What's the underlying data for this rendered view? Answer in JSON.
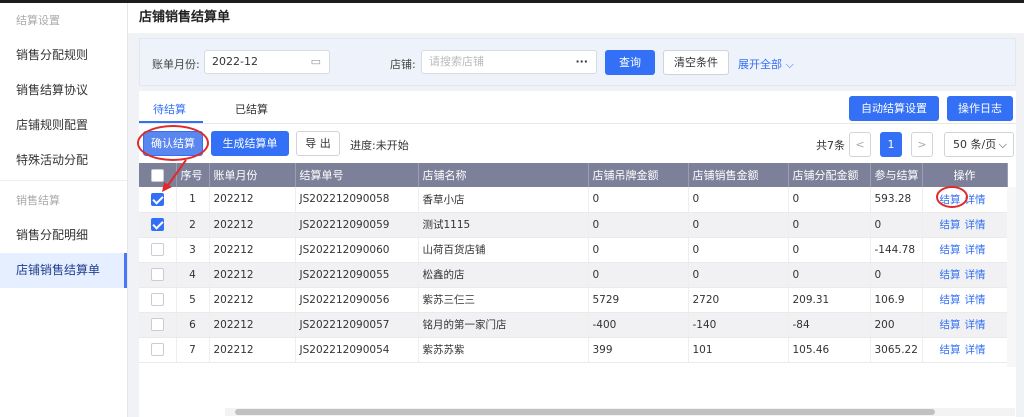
{
  "sidebar": {
    "items": [
      {
        "label": "结算设置",
        "type": "group"
      },
      {
        "label": "销售分配规则",
        "type": "item"
      },
      {
        "label": "销售结算协议",
        "type": "item"
      },
      {
        "label": "店铺规则配置",
        "type": "item"
      },
      {
        "label": "特殊活动分配",
        "type": "item"
      },
      {
        "label": "销售结算",
        "type": "group"
      },
      {
        "label": "销售分配明细",
        "type": "item"
      },
      {
        "label": "店铺销售结算单",
        "type": "active"
      }
    ]
  },
  "page": {
    "title": "店铺销售结算单"
  },
  "filter": {
    "month_label": "账单月份:",
    "month_value": "2022-12",
    "store_label": "店铺:",
    "store_placeholder": "请搜索店铺",
    "store_more": "···",
    "query_btn": "查询",
    "clear_btn": "清空条件",
    "expand_link": "展开全部"
  },
  "tabs": {
    "pending": "待结算",
    "settled": "已结算"
  },
  "toolbar": {
    "auto_settle_btn": "自动结算设置",
    "log_btn": "操作日志",
    "confirm_btn": "确认结算",
    "generate_btn": "生成结算单",
    "export_btn": "导 出",
    "progress": "进度:未开始",
    "total": "共7条",
    "prev": "<",
    "page": "1",
    "next": ">",
    "page_size": "50 条/页"
  },
  "table": {
    "headers": [
      "序号",
      "账单月份",
      "结算单号",
      "店铺名称",
      "店铺吊牌金额",
      "店铺销售金额",
      "店铺分配金额",
      "参与结算",
      "操作"
    ],
    "rows": [
      {
        "checked": true,
        "no": "1",
        "month": "202212",
        "code": "JS202212090058",
        "store": "香草小店",
        "tag": "0",
        "sale": "0",
        "alloc": "0",
        "settle": "593.28"
      },
      {
        "checked": true,
        "no": "2",
        "month": "202212",
        "code": "JS202212090059",
        "store": "测试1115",
        "tag": "0",
        "sale": "0",
        "alloc": "0",
        "settle": "0"
      },
      {
        "checked": false,
        "no": "3",
        "month": "202212",
        "code": "JS202212090060",
        "store": "山荷百货店铺",
        "tag": "0",
        "sale": "0",
        "alloc": "0",
        "settle": "-144.78"
      },
      {
        "checked": false,
        "no": "4",
        "month": "202212",
        "code": "JS202212090055",
        "store": "松鑫的店",
        "tag": "0",
        "sale": "0",
        "alloc": "0",
        "settle": "0"
      },
      {
        "checked": false,
        "no": "5",
        "month": "202212",
        "code": "JS202212090056",
        "store": "紫苏三仨三",
        "tag": "5729",
        "sale": "2720",
        "alloc": "209.31",
        "settle": "106.9"
      },
      {
        "checked": false,
        "no": "6",
        "month": "202212",
        "code": "JS202212090057",
        "store": "铭月的第一家门店",
        "tag": "-400",
        "sale": "-140",
        "alloc": "-84",
        "settle": "200"
      },
      {
        "checked": false,
        "no": "7",
        "month": "202212",
        "code": "JS202212090054",
        "store": "紫苏苏紫",
        "tag": "399",
        "sale": "101",
        "alloc": "105.46",
        "settle": "3065.22"
      }
    ],
    "op_settle": "结算",
    "op_detail": "详情"
  },
  "colors": {
    "primary": "#3370f5",
    "header": "#7c8099",
    "highlight": "#e02a2a"
  }
}
